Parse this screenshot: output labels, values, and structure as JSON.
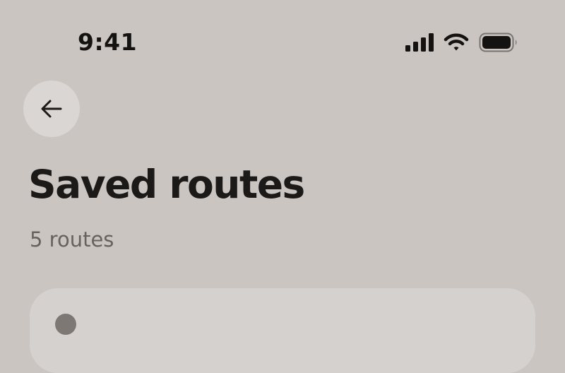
{
  "status_bar": {
    "time": "9:41",
    "icons": [
      "cellular-signal-icon",
      "wifi-icon",
      "battery-icon"
    ]
  },
  "header": {
    "back_icon": "arrow-left-icon"
  },
  "main": {
    "title": "Saved routes",
    "subtitle": "5 routes"
  },
  "colors": {
    "background": "#cac5c0",
    "back_button": "#d9d6d3",
    "card": "#d5d1ce",
    "text_primary": "#1b1a19",
    "text_secondary": "#66625e"
  }
}
